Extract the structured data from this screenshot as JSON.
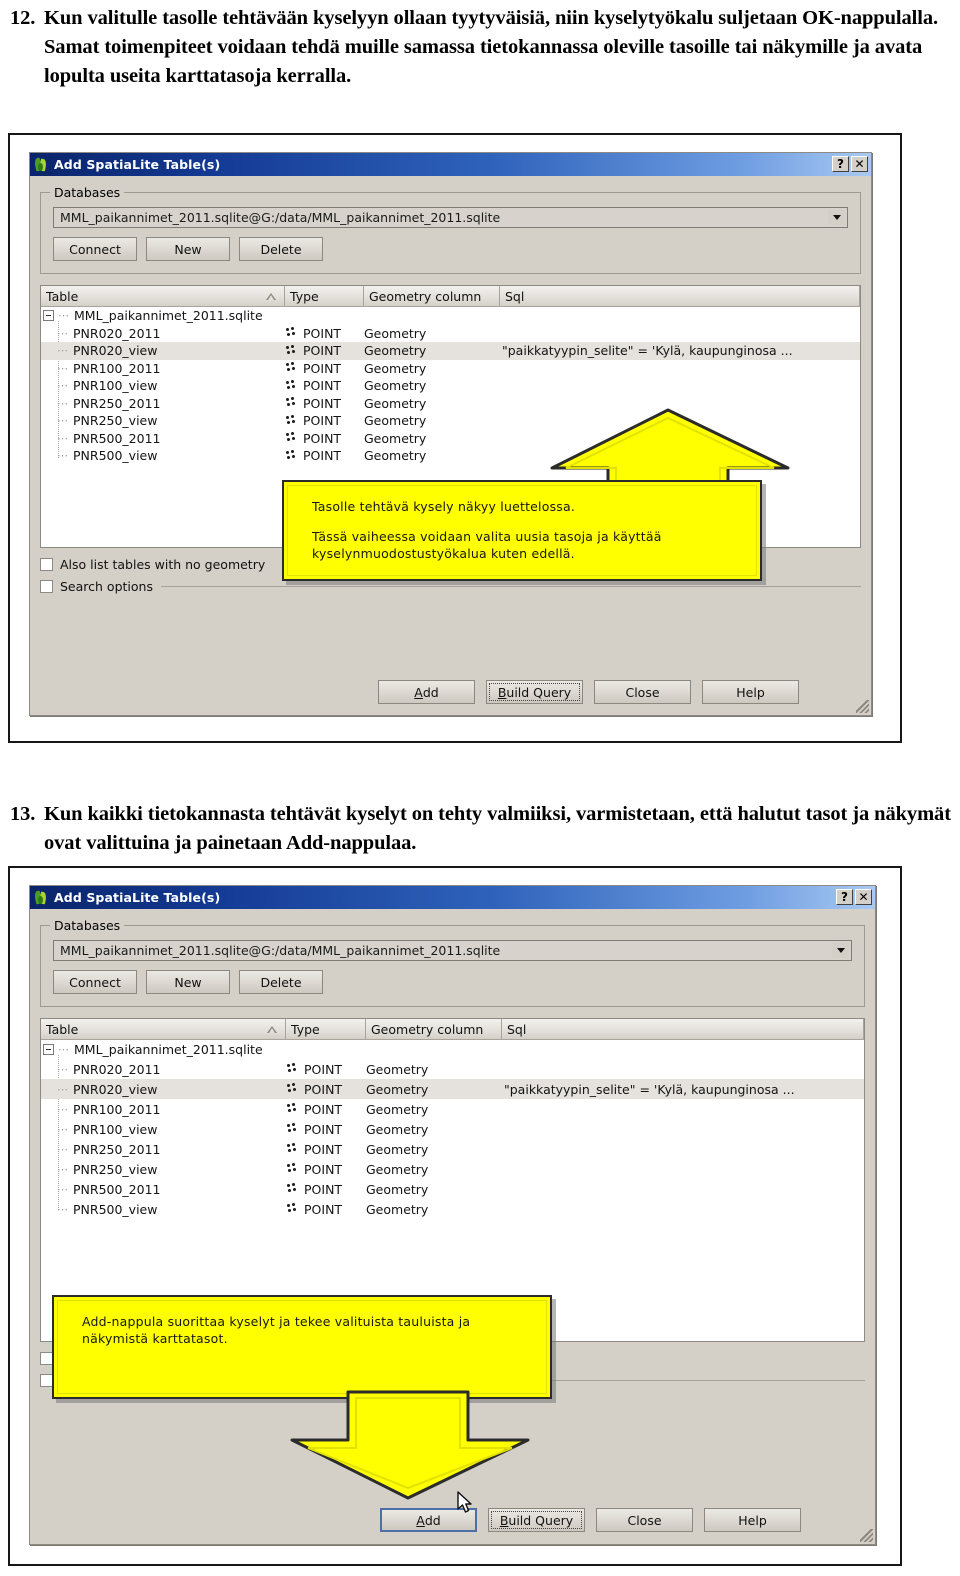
{
  "instructions": {
    "step12": {
      "number": "12.",
      "text": "Kun valitulle tasolle tehtävään kyselyyn ollaan tyytyväisiä, niin kyselytyökalu suljetaan OK-nappulalla.  Samat toimenpiteet voidaan tehdä muille samassa tietokannassa oleville tasoille tai näkymille ja avata lopulta useita karttatasoja kerralla."
    },
    "step13": {
      "number": "13.",
      "text": "Kun kaikki tietokannasta tehtävät kyselyt on tehty valmiiksi, varmistetaan, että halutut tasot ja näkymät ovat valittuina ja painetaan Add-nappulaa."
    }
  },
  "dialog": {
    "title": "Add SpatiaLite Table(s)",
    "title_icon": "qgis-leaf-icon",
    "titlebar_buttons": [
      {
        "name": "help-title-button",
        "label": "?"
      },
      {
        "name": "close-title-button",
        "label": "✕"
      }
    ],
    "databases_group": {
      "legend": "Databases",
      "connection_value": "MML_paikannimet_2011.sqlite@G:/data/MML_paikannimet_2011.sqlite",
      "buttons": [
        {
          "name": "connect-button",
          "label": "Connect"
        },
        {
          "name": "new-button",
          "label": "New"
        },
        {
          "name": "delete-button",
          "label": "Delete"
        }
      ]
    },
    "table_view": {
      "columns": [
        "Table",
        "Type",
        "Geometry column",
        "Sql"
      ],
      "sort_indicator": "ascending",
      "root": "MML_paikannimet_2011.sqlite",
      "rows": [
        {
          "table": "PNR020_2011",
          "type": "POINT",
          "geometry": "Geometry",
          "sql": "",
          "selected": false
        },
        {
          "table": "PNR020_view",
          "type": "POINT",
          "geometry": "Geometry",
          "sql": "\"paikkatyypin_selite\" = 'Kylä, kaupunginosa ...",
          "selected": true
        },
        {
          "table": "PNR100_2011",
          "type": "POINT",
          "geometry": "Geometry",
          "sql": "",
          "selected": false
        },
        {
          "table": "PNR100_view",
          "type": "POINT",
          "geometry": "Geometry",
          "sql": "",
          "selected": false
        },
        {
          "table": "PNR250_2011",
          "type": "POINT",
          "geometry": "Geometry",
          "sql": "",
          "selected": false
        },
        {
          "table": "PNR250_view",
          "type": "POINT",
          "geometry": "Geometry",
          "sql": "",
          "selected": false
        },
        {
          "table": "PNR500_2011",
          "type": "POINT",
          "geometry": "Geometry",
          "sql": "",
          "selected": false
        },
        {
          "table": "PNR500_view",
          "type": "POINT",
          "geometry": "Geometry",
          "sql": "",
          "selected": false
        }
      ]
    },
    "options": [
      {
        "name": "also-list-tables-checkbox",
        "label": "Also list tables with no geometry",
        "checked": false
      },
      {
        "name": "search-options-checkbox",
        "label": "Search options",
        "checked": false
      }
    ],
    "action_buttons": [
      {
        "name": "add-button",
        "label": "Add",
        "mnemonic": "A"
      },
      {
        "name": "build-query-button",
        "label": "Build Query",
        "mnemonic": "B"
      },
      {
        "name": "close-button",
        "label": "Close",
        "mnemonic": ""
      },
      {
        "name": "help-button",
        "label": "Help",
        "mnemonic": ""
      }
    ]
  },
  "callouts": {
    "first": {
      "line1": "Tasolle tehtävä kysely näkyy luettelossa.",
      "line2": "Tässä vaiheessa voidaan valita uusia tasoja ja käyttää kyselynmuodostustyökalua kuten edellä.",
      "color": "#ffff00",
      "arrow": "up"
    },
    "second": {
      "line1": "Add-nappula suorittaa kyselyt ja tekee valituista tauluista ja näkymistä karttatasot.",
      "color": "#ffff00",
      "arrow": "down"
    }
  },
  "colors": {
    "titlebar_start": "#0a246a",
    "titlebar_end": "#a9c9f2",
    "dialog_face": "#d4d0c8",
    "callout_yellow": "#ffff00",
    "selection_row": "#e5e2dd"
  }
}
